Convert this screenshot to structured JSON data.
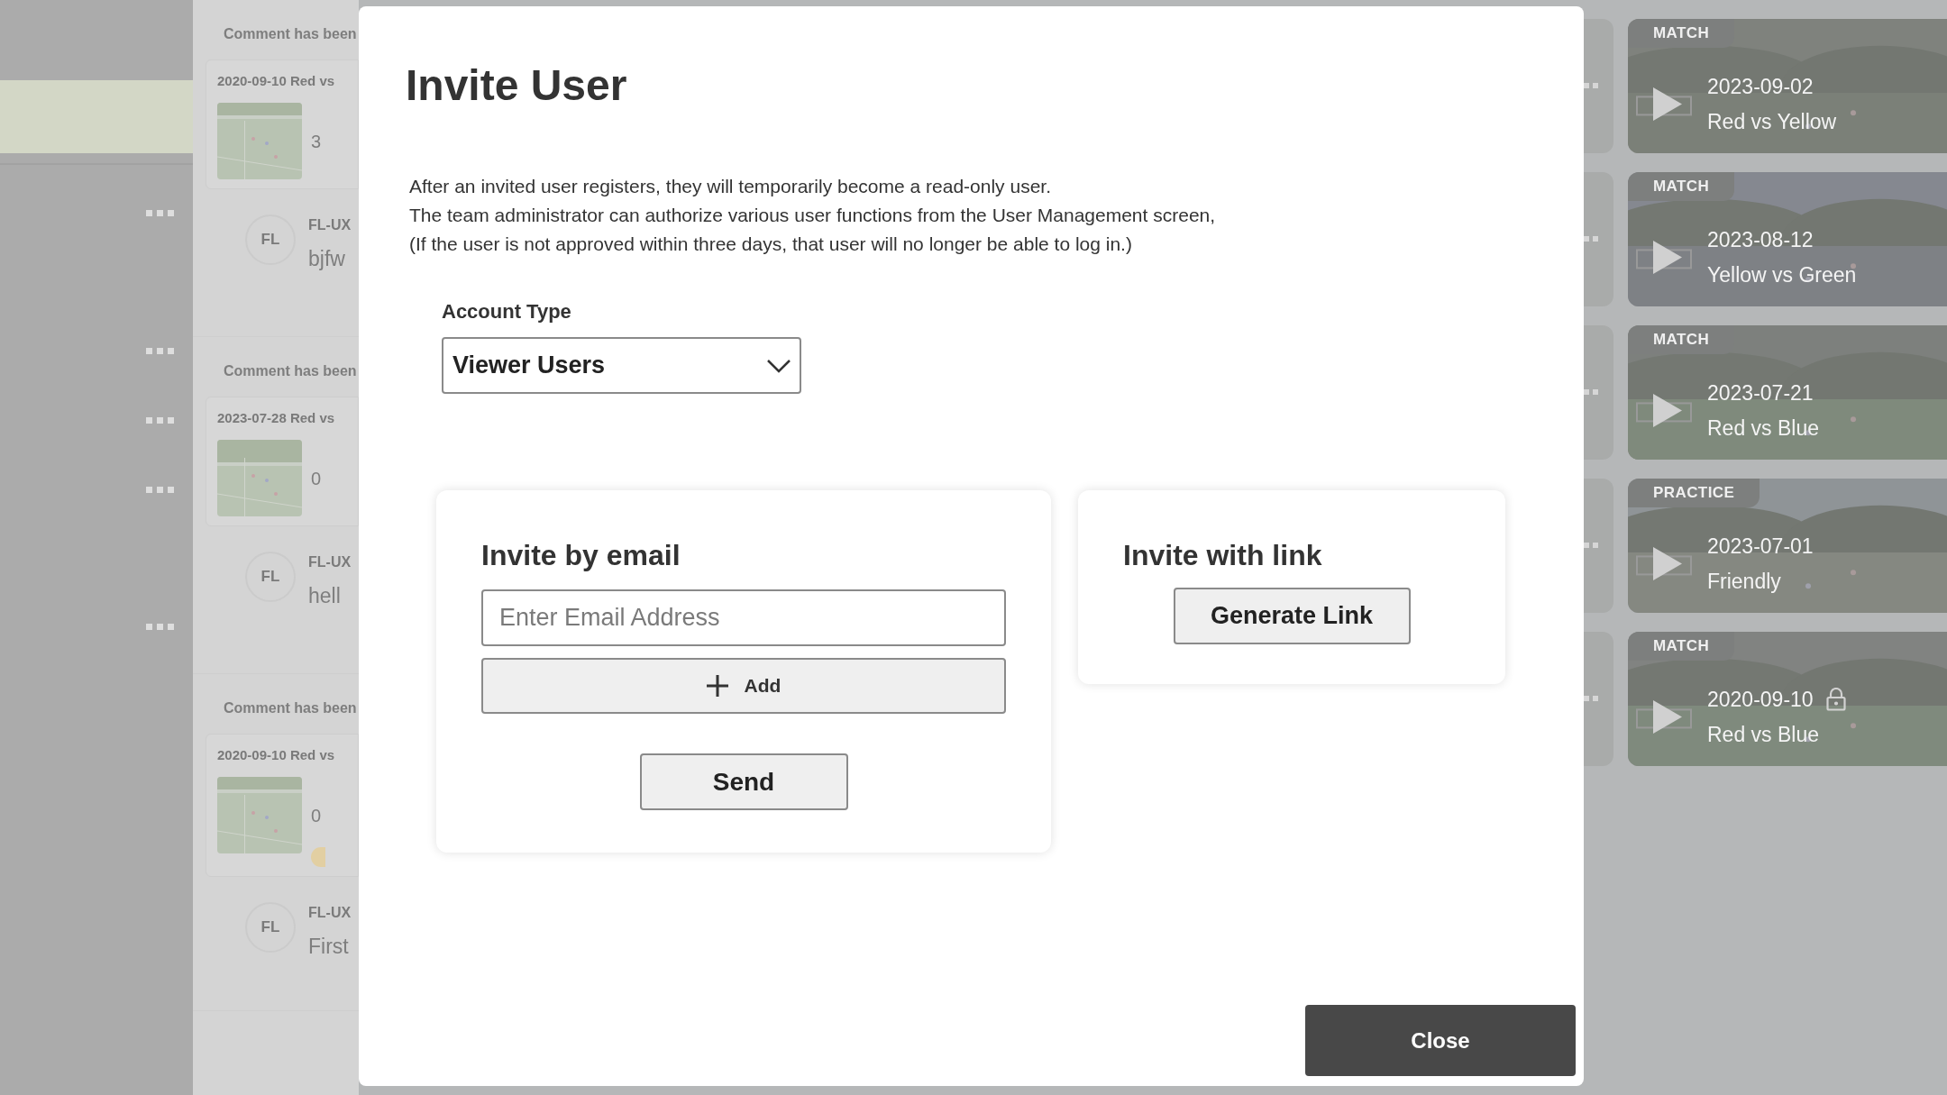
{
  "comments": [
    {
      "notice": "Comment has been",
      "video_title": "2020-09-10 Red vs",
      "time": "3",
      "marker": false,
      "avatar": "FL",
      "author": "FL-UX",
      "text": "bjfw"
    },
    {
      "notice": "Comment has been",
      "video_title": "2023-07-28 Red vs",
      "time": "0",
      "marker": false,
      "avatar": "FL",
      "author": "FL-UX",
      "text": "hell"
    },
    {
      "notice": "Comment has been",
      "video_title": "2020-09-10 Red vs",
      "time": "0",
      "marker": true,
      "avatar": "FL",
      "author": "FL-UX",
      "text": "First"
    }
  ],
  "videos": [
    {
      "tag": "MATCH",
      "date": "2023-09-02",
      "title": "Red vs Yellow",
      "locked": false
    },
    {
      "tag": "MATCH",
      "date": "2023-08-12",
      "title": "Yellow vs Green",
      "locked": false
    },
    {
      "tag": "MATCH",
      "date": "2023-07-21",
      "title": "Red vs Blue",
      "locked": false
    },
    {
      "tag": "PRACTICE",
      "date": "2023-07-01",
      "title": "Friendly",
      "locked": false
    },
    {
      "tag": "MATCH",
      "date": "2020-09-10",
      "title": "Red vs Blue",
      "locked": true
    }
  ],
  "dialog": {
    "title": "Invite User",
    "description": [
      "After an invited user registers, they will temporarily become a read-only user.",
      "The team administrator can authorize various user functions from the User Management screen,",
      "(If the user is not approved within three days, that user will no longer be able to log in.)"
    ],
    "account_type": {
      "label": "Account Type",
      "value": "Viewer Users"
    },
    "email_panel": {
      "title": "Invite by email",
      "placeholder": "Enter Email Address",
      "add_button": "Add",
      "send_button": "Send"
    },
    "link_panel": {
      "title": "Invite with link",
      "generate_button": "Generate Link"
    },
    "close_button": "Close"
  }
}
